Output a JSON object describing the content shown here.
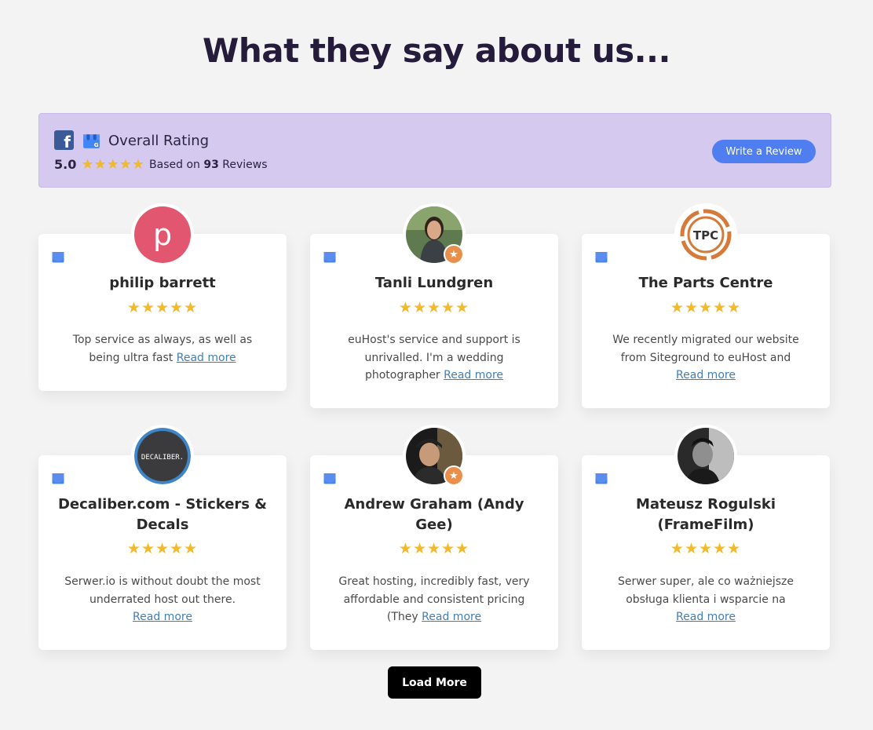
{
  "page": {
    "title": "What they say about us..."
  },
  "rating": {
    "label": "Overall Rating",
    "score": "5.0",
    "stars": "★★★★★",
    "based_on": "Based on",
    "count": "93",
    "reviews_word": "Reviews",
    "write_button": "Write a Review",
    "icons": [
      "facebook-icon",
      "google-my-business-icon"
    ]
  },
  "reviews": [
    {
      "name": "philip barrett",
      "avatar_text": "p",
      "stars": "★★★★★",
      "text": "Top service as always, as well as being ultra fast",
      "read_more": "Read more"
    },
    {
      "name": "Tanli Lundgren",
      "avatar_text": "",
      "badge": "★",
      "stars": "★★★★★",
      "text": "euHost's service and support is unrivalled. I'm a wedding photographer",
      "read_more": "Read more"
    },
    {
      "name": "The Parts Centre",
      "avatar_text": "TPC",
      "stars": "★★★★★",
      "text": "We recently migrated our website from Siteground to euHost and",
      "read_more": "Read more"
    },
    {
      "name": "Decaliber.com - Stickers & Decals",
      "avatar_text": "DECALIBER.",
      "stars": "★★★★★",
      "text": "Serwer.io is without doubt the most underrated host out there.",
      "read_more": "Read more"
    },
    {
      "name": "Andrew Graham (Andy Gee)",
      "avatar_text": "",
      "badge": "★",
      "stars": "★★★★★",
      "text": "Great hosting, incredibly fast, very affordable and consistent pricing (They",
      "read_more": "Read more"
    },
    {
      "name": "Mateusz Rogulski (FrameFilm)",
      "avatar_text": "",
      "stars": "★★★★★",
      "text": "Serwer super, ale co ważniejsze obsługa klienta i wsparcie na",
      "read_more": "Read more"
    }
  ],
  "load_more": "Load More",
  "colors": {
    "background": "#f3f3f4",
    "rating_bar": "#d5c9f0",
    "accent_button": "#4f7ef0",
    "star": "#f2b928",
    "link": "#3f7fb8"
  }
}
